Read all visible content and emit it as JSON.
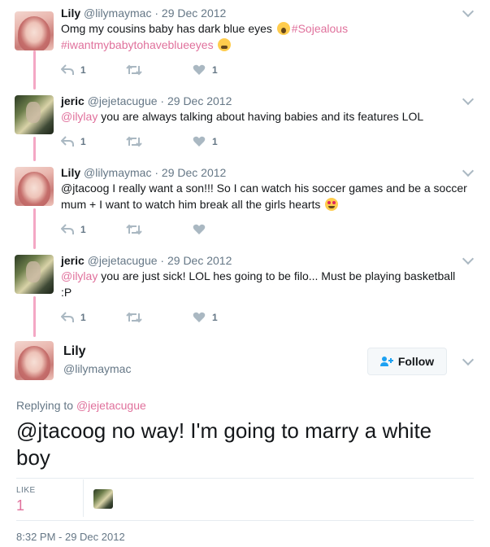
{
  "thread": [
    {
      "name": "Lily",
      "handle": "@lilymaymac",
      "sep": "·",
      "date": "29 Dec 2012",
      "text_before": "Omg my cousins baby has dark blue eyes",
      "emoji1": "scream",
      "hashtag1": "#Sojealous",
      "hashtag2": "#iwantmybabytohaveblueeyes",
      "emoji2": "tired",
      "reply_count": "1",
      "retweet_count": "",
      "like_count": "1"
    },
    {
      "name": "jeric",
      "handle": "@jejetacugue",
      "sep": "·",
      "date": "29 Dec 2012",
      "mention": "@ilylay",
      "text": " you are always talking about having babies and its features LOL",
      "reply_count": "1",
      "retweet_count": "",
      "like_count": "1"
    },
    {
      "name": "Lily",
      "handle": "@lilymaymac",
      "sep": "·",
      "date": "29 Dec 2012",
      "text": "@jtacoog I really want a son!!! So I can watch his soccer games and be a soccer mum + I want to watch him break all the girls hearts",
      "emoji": "heart-eyes",
      "reply_count": "1",
      "retweet_count": "",
      "like_count": ""
    },
    {
      "name": "jeric",
      "handle": "@jejetacugue",
      "sep": "·",
      "date": "29 Dec 2012",
      "mention": "@ilylay",
      "text": " you are just sick! LOL hes going to be filo... Must be playing basketball :P",
      "reply_count": "1",
      "retweet_count": "",
      "like_count": "1"
    }
  ],
  "main_tweet": {
    "name": "Lily",
    "handle": "@lilymaymac",
    "follow_label": "Follow",
    "replying_prefix": "Replying to",
    "replying_to": "@jejetacugue",
    "text": "@jtacoog no way! I'm going to marry a white boy",
    "like_label": "LIKE",
    "like_count": "1",
    "timestamp": "8:32 PM - 29 Dec 2012"
  },
  "colors": {
    "accent": "#e0719c",
    "thread_line": "#f4a7c4",
    "secondary_text": "#657786"
  }
}
